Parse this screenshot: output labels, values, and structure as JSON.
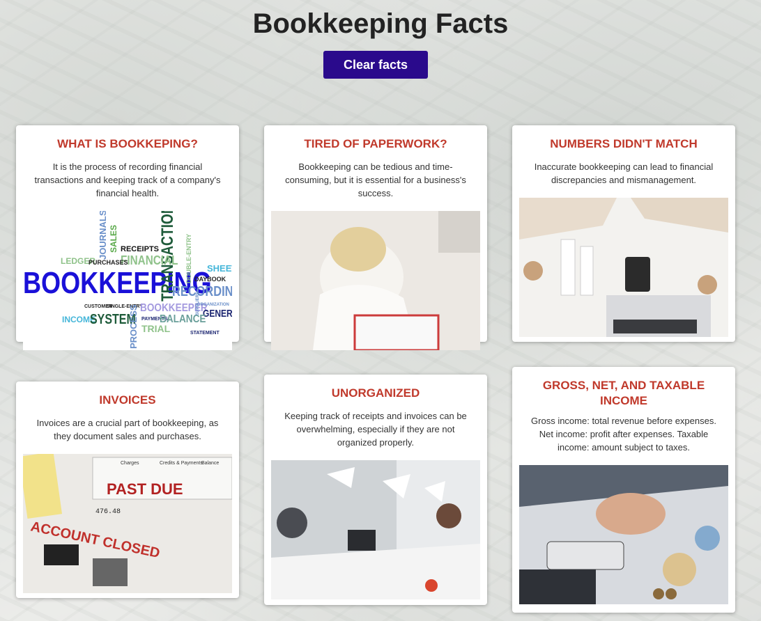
{
  "page": {
    "title": "Bookkeeping Facts"
  },
  "toolbar": {
    "clear_label": "Clear facts"
  },
  "colors": {
    "accent": "#2a0a8c",
    "card_title": "#c0392b"
  },
  "cards": [
    {
      "title": "WHAT IS BOOKKEPING?",
      "text": "It is the process of recording financial transactions and keeping track of a company's financial health."
    },
    {
      "title": "TIRED OF PAPERWORK?",
      "text": "Bookkeeping can be tedious and time-consuming, but it is essential for a business's success."
    },
    {
      "title": "NUMBERS DIDN'T MATCH",
      "text": "Inaccurate bookkeeping can lead to financial discrepancies and mismanagement."
    },
    {
      "title": "INVOICES",
      "text": "Invoices are a crucial part of bookkeeping, as they document sales and purchases."
    },
    {
      "title": "UNORGANIZED",
      "text": "Keeping track of receipts and invoices can be overwhelming, especially if they are not organized properly."
    },
    {
      "title": "GROSS, NET, AND TAXABLE INCOME",
      "text": "Gross income: total revenue before expenses. Net income: profit after expenses. Taxable income: amount subject to taxes."
    }
  ],
  "wordcloud": {
    "words": [
      "BOOKKEEPING",
      "TRANSACTION",
      "FINANCIAL",
      "JOURNALS",
      "SALES",
      "RECEIPTS",
      "LEDGER",
      "PURCHASES",
      "SHEET",
      "DOUBLE-ENTRY",
      "DAYBOOK",
      "RECORDING",
      "CUSTOMER",
      "SINGLE-ENTRY",
      "BOOKKEEPER",
      "ORGANIZATION",
      "GENERAL",
      "INCOME",
      "SYSTEM",
      "PAYMENTS",
      "BALANCE",
      "SUPPLIERS",
      "TRIAL",
      "PROCESS",
      "STATEMENT"
    ]
  },
  "invoice_image": {
    "past_due": "PAST DUE",
    "account_closed": "ACCOUNT CLOSED",
    "charges": "Charges",
    "credits": "Credits & Payments",
    "balance": "Balance",
    "amount": "476.48"
  }
}
